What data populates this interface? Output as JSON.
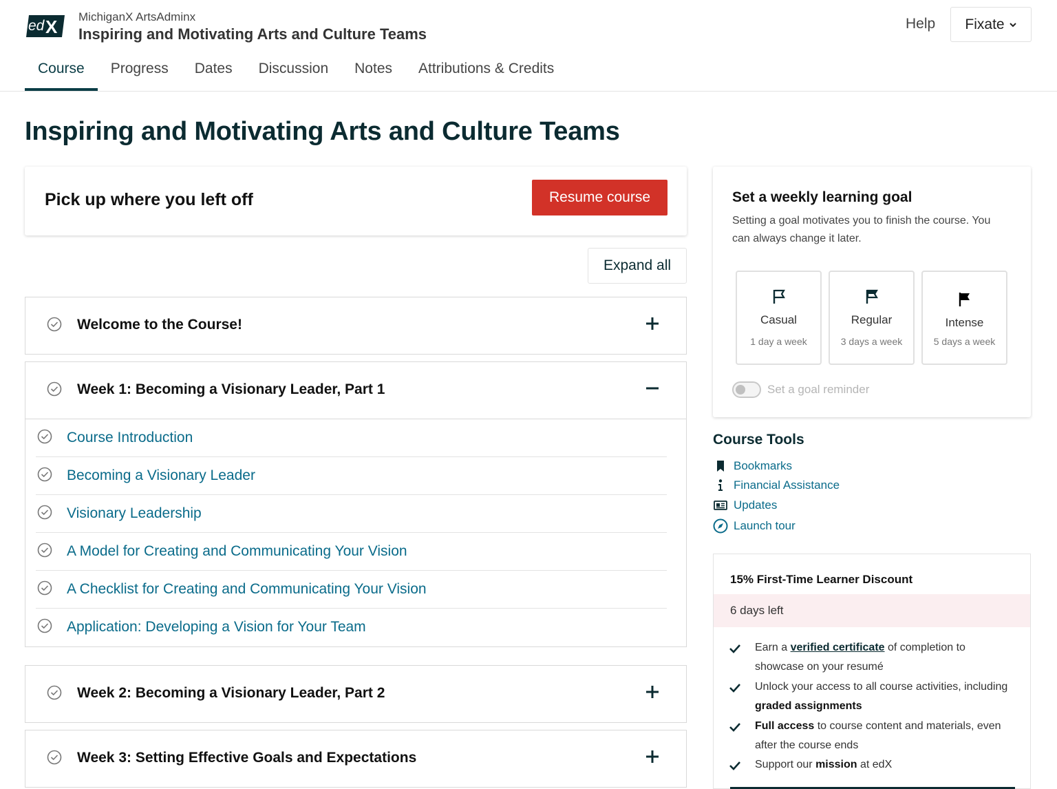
{
  "header": {
    "logo_text": "edX",
    "org": "MichiganX ArtsAdminx",
    "course_title": "Inspiring and Motivating Arts and Culture Teams",
    "help": "Help",
    "user": "Fixate"
  },
  "tabs": [
    {
      "label": "Course",
      "active": true
    },
    {
      "label": "Progress"
    },
    {
      "label": "Dates"
    },
    {
      "label": "Discussion"
    },
    {
      "label": "Notes"
    },
    {
      "label": "Attributions & Credits"
    }
  ],
  "page_title": "Inspiring and Motivating Arts and Culture Teams",
  "resume": {
    "heading": "Pick up where you left off",
    "button": "Resume course"
  },
  "expand_all": "Expand all",
  "sections": [
    {
      "title": "Welcome to the Course!",
      "expanded": false,
      "subsections": []
    },
    {
      "title": "Week 1: Becoming a Visionary Leader, Part 1",
      "expanded": true,
      "subsections": [
        "Course Introduction",
        "Becoming a Visionary Leader",
        "Visionary Leadership",
        "A Model for Creating and Communicating Your Vision",
        "A Checklist for Creating and Communicating Your Vision",
        "Application: Developing a Vision for Your Team"
      ]
    },
    {
      "title": "Week 2: Becoming a Visionary Leader, Part 2",
      "expanded": false,
      "subsections": []
    },
    {
      "title": "Week 3: Setting Effective Goals and Expectations",
      "expanded": false,
      "subsections": []
    }
  ],
  "goal": {
    "title": "Set a weekly learning goal",
    "description": "Setting a goal motivates you to finish the course. You can always change it later.",
    "options": [
      {
        "name": "Casual",
        "freq": "1 day a week",
        "icon": "flag-outline-icon"
      },
      {
        "name": "Regular",
        "freq": "3 days a week",
        "icon": "flag-half-icon"
      },
      {
        "name": "Intense",
        "freq": "5 days a week",
        "icon": "flag-filled-icon"
      }
    ],
    "reminder_label": "Set a goal reminder"
  },
  "tools": {
    "title": "Course Tools",
    "items": [
      {
        "label": "Bookmarks",
        "icon": "bookmark-icon"
      },
      {
        "label": "Financial Assistance",
        "icon": "info-icon"
      },
      {
        "label": "Updates",
        "icon": "newspaper-icon"
      },
      {
        "label": "Launch tour",
        "icon": "compass-icon"
      }
    ]
  },
  "discount": {
    "title": "15% First-Time Learner Discount",
    "days_left": "6 days left",
    "benefits": {
      "b1_pre": "Earn a ",
      "b1_link": "verified certificate",
      "b1_post": " of completion to showcase on your resumé",
      "b2_pre": "Unlock your access to all course activities, including ",
      "b2_bold": "graded assignments",
      "b3_bold": "Full access",
      "b3_post": " to course content and materials, even after the course ends",
      "b4_pre": "Support our ",
      "b4_bold": "mission",
      "b4_post": " at edX"
    }
  },
  "colors": {
    "brand_dark": "#0b2b31",
    "link": "#0a6b8a",
    "resume_button": "#d23228",
    "discount_band": "#fbeef0"
  }
}
